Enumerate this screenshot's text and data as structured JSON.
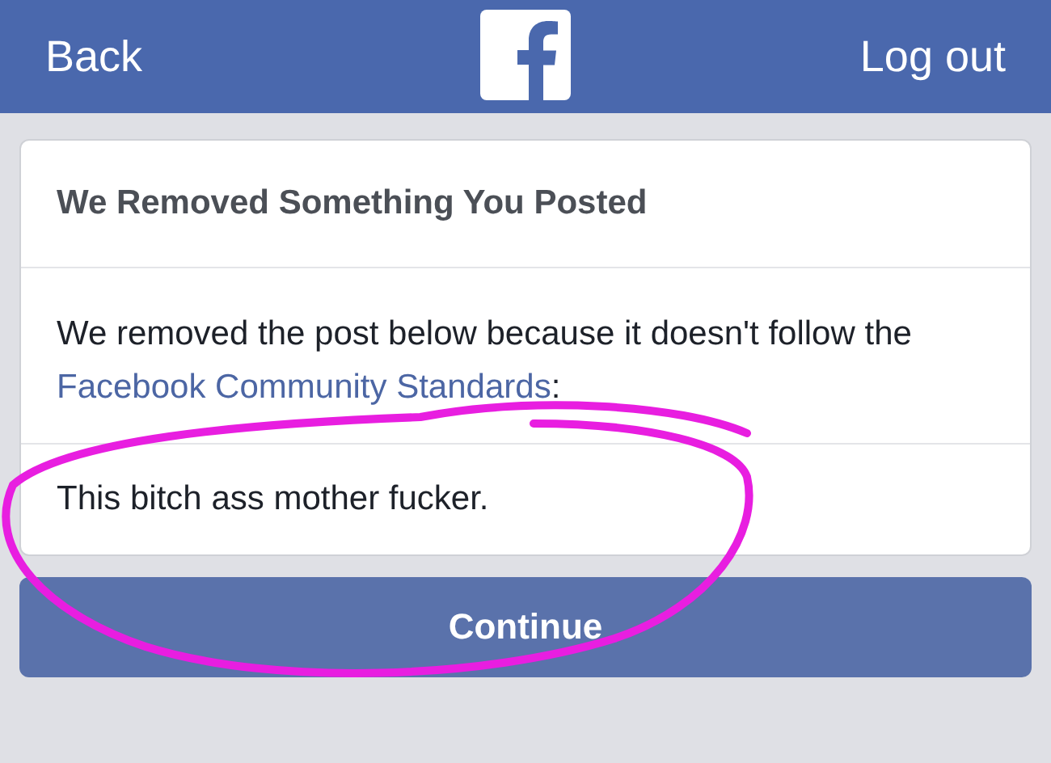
{
  "header": {
    "back": "Back",
    "logout": "Log out"
  },
  "card": {
    "title": "We Removed Something You Posted",
    "message_start": "We removed the post below because it doesn't follow the ",
    "link": "Facebook Community Standards",
    "message_end": ":",
    "post": "This bitch ass mother fucker."
  },
  "button": "Continue"
}
